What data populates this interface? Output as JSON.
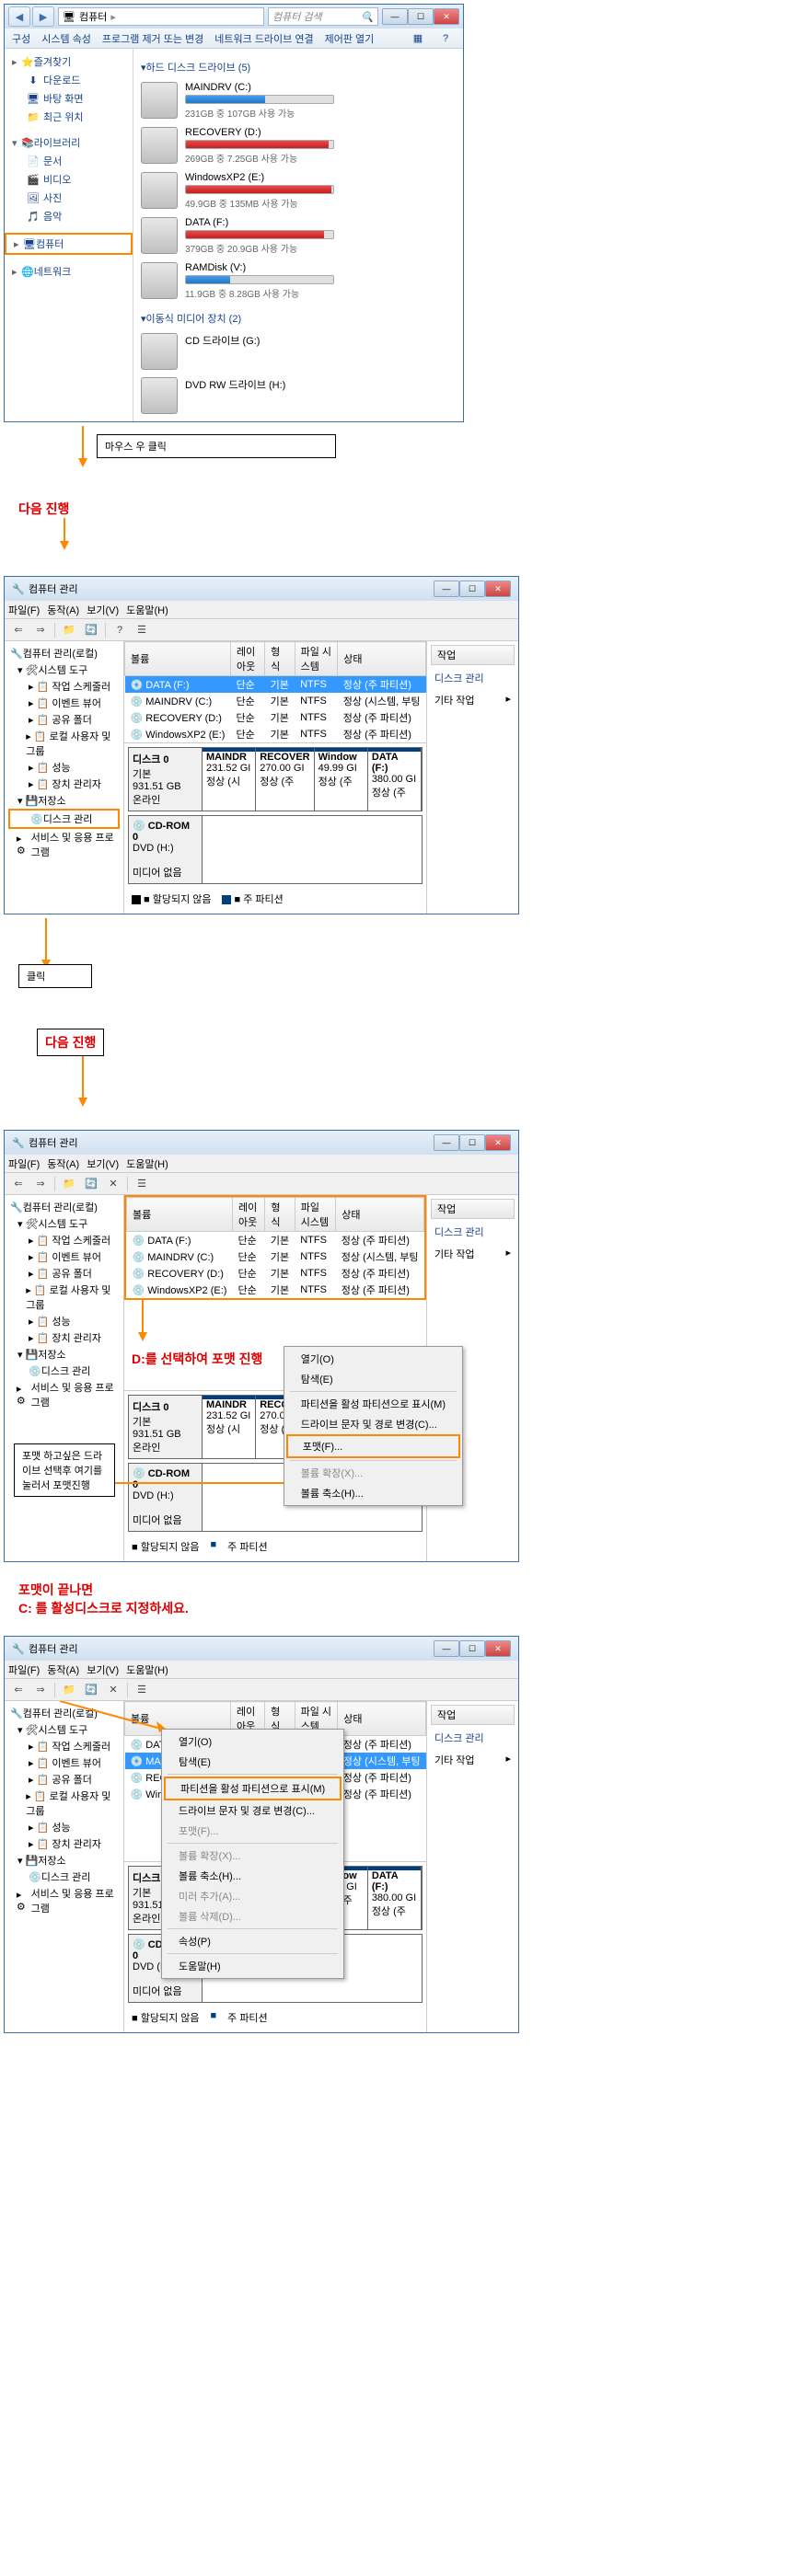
{
  "explorer": {
    "title": "컴퓨터",
    "search_placeholder": "컴퓨터 검색",
    "breadcrumb": "컴퓨터",
    "menu": [
      "구성",
      "시스템 속성",
      "프로그램 제거 또는 변경",
      "네트워크 드라이브 연결",
      "제어판 열기"
    ],
    "sidebar": {
      "favorites": {
        "label": "즐겨찾기",
        "items": [
          "다운로드",
          "바탕 화면",
          "최근 위치"
        ]
      },
      "libraries": {
        "label": "라이브러리",
        "items": [
          "문서",
          "비디오",
          "사진",
          "음악"
        ]
      },
      "computer": {
        "label": "컴퓨터"
      },
      "network": {
        "label": "네트워크"
      }
    },
    "sections": {
      "hdd": {
        "label": "하드 디스크 드라이브 (5)"
      },
      "removable": {
        "label": "이동식 미디어 장치 (2)"
      }
    },
    "drives": [
      {
        "name": "MAINDRV (C:)",
        "status": "231GB 중 107GB 사용 가능",
        "fill": 54,
        "red": false
      },
      {
        "name": "RECOVERY (D:)",
        "status": "269GB 중 7.25GB 사용 가능",
        "fill": 97,
        "red": true
      },
      {
        "name": "WindowsXP2 (E:)",
        "status": "49.9GB 중 135MB 사용 가능",
        "fill": 99,
        "red": true
      },
      {
        "name": "DATA (F:)",
        "status": "379GB 중 20.9GB 사용 가능",
        "fill": 94,
        "red": true
      },
      {
        "name": "RAMDisk (V:)",
        "status": "11.9GB 중 8.28GB 사용 가능",
        "fill": 30,
        "red": false
      }
    ],
    "removable": [
      {
        "name": "CD 드라이브 (G:)"
      },
      {
        "name": "DVD RW 드라이브 (H:)"
      }
    ]
  },
  "ann": {
    "rightclick": "마우스 우 클릭",
    "next1": "다음 진행",
    "click": "클릭",
    "next2": "다음 진행",
    "select_d": "D:를 선택하여 포맷 진행",
    "format_here": "포맷 하고싶은 드라이브 선택후 여기를 눌러서 포맷진행",
    "after_format": "포맷이 끝나면\nC: 를 활성디스크로 지정하세요."
  },
  "mgmt": {
    "title": "컴퓨터 관리",
    "menu": [
      "파일(F)",
      "동작(A)",
      "보기(V)",
      "도움말(H)"
    ],
    "tree": {
      "root": "컴퓨터 관리(로컬)",
      "systools": "시스템 도구",
      "systools_items": [
        "작업 스케줄러",
        "이벤트 뷰어",
        "공유 폴더",
        "로컬 사용자 및 그룹",
        "성능",
        "장치 관리자"
      ],
      "storage": "저장소",
      "diskmgmt": "디스크 관리",
      "services": "서비스 및 응용 프로그램"
    },
    "vol_headers": [
      "볼륨",
      "레이아웃",
      "형식",
      "파일 시스템",
      "상태"
    ],
    "volumes": [
      {
        "name": "DATA (F:)",
        "layout": "단순",
        "type": "기본",
        "fs": "NTFS",
        "status": "정상 (주 파티션)"
      },
      {
        "name": "MAINDRV (C:)",
        "layout": "단순",
        "type": "기본",
        "fs": "NTFS",
        "status": "정상 (시스템, 부팅"
      },
      {
        "name": "RECOVERY (D:)",
        "layout": "단순",
        "type": "기본",
        "fs": "NTFS",
        "status": "정상 (주 파티션)"
      },
      {
        "name": "WindowsXP2 (E:)",
        "layout": "단순",
        "type": "기본",
        "fs": "NTFS",
        "status": "정상 (주 파티션)"
      }
    ],
    "disk0": {
      "label": "디스크 0",
      "type": "기본",
      "size": "931.51 GB",
      "status": "온라인"
    },
    "parts": [
      {
        "name": "MAINDR",
        "vol": "231.52 GI",
        "st": "정상 (시"
      },
      {
        "name": "RECOVER",
        "vol": "270.00 GI",
        "st": "정상 (주"
      },
      {
        "name": "Window",
        "vol": "49.99 GI",
        "st": "정상 (주"
      },
      {
        "name": "DATA (F:)",
        "vol": "380.00 GI",
        "st": "정상 (주"
      }
    ],
    "cdrom": {
      "label": "CD-ROM 0",
      "drive": "DVD (H:)",
      "status": "미디어 없음"
    },
    "legend": {
      "unalloc": "할당되지 않음",
      "primary": "주 파티션"
    },
    "actions": {
      "header": "작업",
      "diskmgmt": "디스크 관리",
      "other": "기타 작업"
    }
  },
  "ctx1": {
    "items": [
      "열기(O)",
      "탐색(E)",
      "파티션을 활성 파티션으로 표시(M)",
      "드라이브 문자 및 경로 변경(C)...",
      "포맷(F)...",
      "볼륨 확장(X)...",
      "볼륨 축소(H)..."
    ]
  },
  "ctx2": {
    "items": [
      "열기(O)",
      "탐색(E)",
      "파티션을 활성 파티션으로 표시(M)",
      "드라이브 문자 및 경로 변경(C)...",
      "포맷(F)...",
      "볼륨 확장(X)...",
      "볼륨 축소(H)...",
      "미러 추가(A)...",
      "볼륨 삭제(D)...",
      "속성(P)",
      "도움말(H)"
    ]
  }
}
